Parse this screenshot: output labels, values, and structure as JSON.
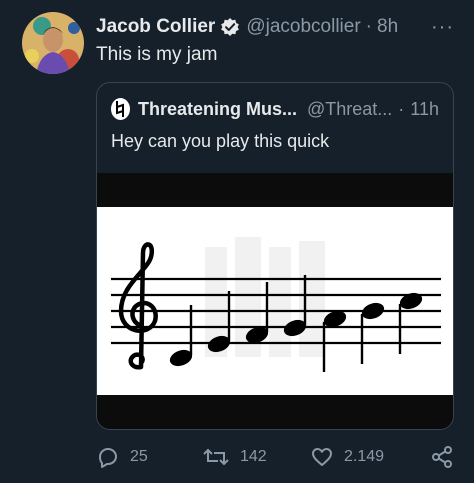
{
  "tweet": {
    "author_name": "Jacob Collier",
    "handle": "@jacobcollier",
    "separator": "·",
    "time": "8h",
    "text": "This is my jam",
    "more_label": "···"
  },
  "quote": {
    "author_name": "Threatening Mus...",
    "handle": "@Threat...",
    "separator": "·",
    "time": "11h",
    "text": "Hey can you play this quick"
  },
  "actions": {
    "replies": "25",
    "retweets": "142",
    "likes": "2.149"
  },
  "colors": {
    "background": "#15202b",
    "text": "#e7e9ea",
    "muted": "#8b98a5",
    "border": "#38444d",
    "verified": "#e7e9ea"
  },
  "icons": [
    "avatar",
    "verified-badge-icon",
    "more-icon",
    "natural-sign-icon",
    "reply-icon",
    "retweet-icon",
    "like-icon",
    "share-icon"
  ]
}
